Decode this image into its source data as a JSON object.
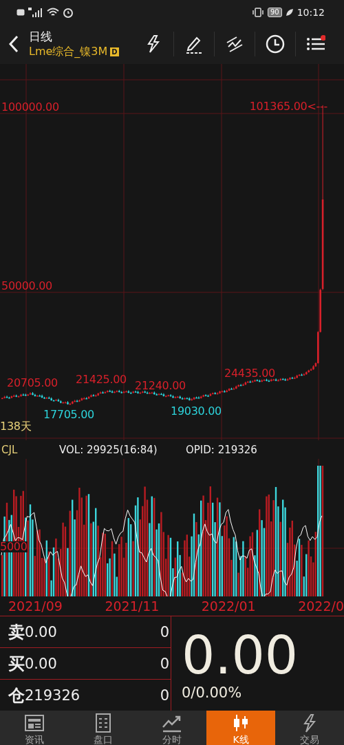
{
  "status_bar": {
    "battery": "90",
    "time": "10:12"
  },
  "header": {
    "title": "日线",
    "symbol": "Lme综合_镍3M",
    "badge": "D"
  },
  "price_chart": {
    "axis_labels": [
      "100000.00",
      "50000.00"
    ],
    "high_marker": "101365.00<---",
    "annotations": [
      {
        "text": "20705.00",
        "kind": "high"
      },
      {
        "text": "21425.00",
        "kind": "high"
      },
      {
        "text": "21240.00",
        "kind": "high"
      },
      {
        "text": "24435.00",
        "kind": "high"
      },
      {
        "text": "17705.00",
        "kind": "low"
      },
      {
        "text": "19030.00",
        "kind": "low"
      }
    ],
    "period": "138天"
  },
  "indicators": {
    "name": "CJL",
    "vol": "VOL: 29925(16:84)",
    "opid": "OPID: 219326"
  },
  "volume_chart": {
    "axis_label": "5000"
  },
  "dates": [
    "2021/09",
    "2021/11",
    "2022/01",
    "2022/0"
  ],
  "quote": {
    "rows": [
      {
        "label": "卖",
        "price": "0.00",
        "qty": "0"
      },
      {
        "label": "买",
        "price": "0.00",
        "qty": "0"
      },
      {
        "label": "仓",
        "price": "219326",
        "qty": "0"
      }
    ],
    "last": "0.00",
    "change": "0/0.00%"
  },
  "tabs": [
    {
      "label": "资讯",
      "selected": false
    },
    {
      "label": "盘口",
      "selected": false
    },
    {
      "label": "分时",
      "selected": false
    },
    {
      "label": "K线",
      "selected": true
    },
    {
      "label": "交易",
      "selected": false
    }
  ]
}
